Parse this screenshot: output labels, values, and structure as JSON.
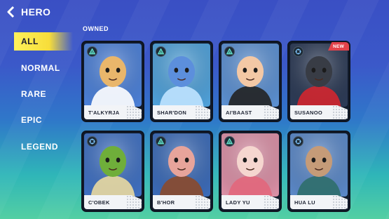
{
  "header": {
    "title": "HERO",
    "back_icon": "back-arrow-icon"
  },
  "sidebar": {
    "items": [
      {
        "label": "ALL",
        "active": true
      },
      {
        "label": "NORMAL",
        "active": false
      },
      {
        "label": "RARE",
        "active": false
      },
      {
        "label": "EPIC",
        "active": false
      },
      {
        "label": "LEGEND",
        "active": false
      }
    ]
  },
  "section": {
    "label": "OWNED"
  },
  "heroes": [
    {
      "name": "T'ALKYRJA",
      "role": "tank-triangle-icon",
      "badge": "",
      "bg": "#4b7fd6",
      "skin": "#e9b66b",
      "accent": "#ffffff"
    },
    {
      "name": "SHAR'DON",
      "role": "tank-triangle-icon",
      "badge": "",
      "bg": "#4fa0d8",
      "skin": "#5c8fdc",
      "accent": "#bfe3ff"
    },
    {
      "name": "AI'BAAST",
      "role": "tank-triangle-icon",
      "badge": "",
      "bg": "#5b8fd0",
      "skin": "#f3c8a5",
      "accent": "#222222"
    },
    {
      "name": "SUSANOO",
      "role": "support-crosshair-icon",
      "badge": "NEW",
      "bg": "#2c3a55",
      "skin": "#383c45",
      "accent": "#d2262f"
    },
    {
      "name": "C'OBEK",
      "role": "support-crosshair-icon",
      "badge": "",
      "bg": "#3f6fc0",
      "skin": "#6fae3a",
      "accent": "#e9d9a0"
    },
    {
      "name": "B'HOR",
      "role": "tank-triangle-icon",
      "badge": "",
      "bg": "#3b6ab6",
      "skin": "#e7a49b",
      "accent": "#8b4a2c"
    },
    {
      "name": "LADY YU",
      "role": "tank-triangle-icon",
      "badge": "",
      "bg": "#d98fa5",
      "skin": "#f5d6cf",
      "accent": "#e2677c"
    },
    {
      "name": "HUA LU",
      "role": "support-crosshair-icon",
      "badge": "",
      "bg": "#5a87c6",
      "skin": "#c59b78",
      "accent": "#2f6e6b"
    }
  ]
}
